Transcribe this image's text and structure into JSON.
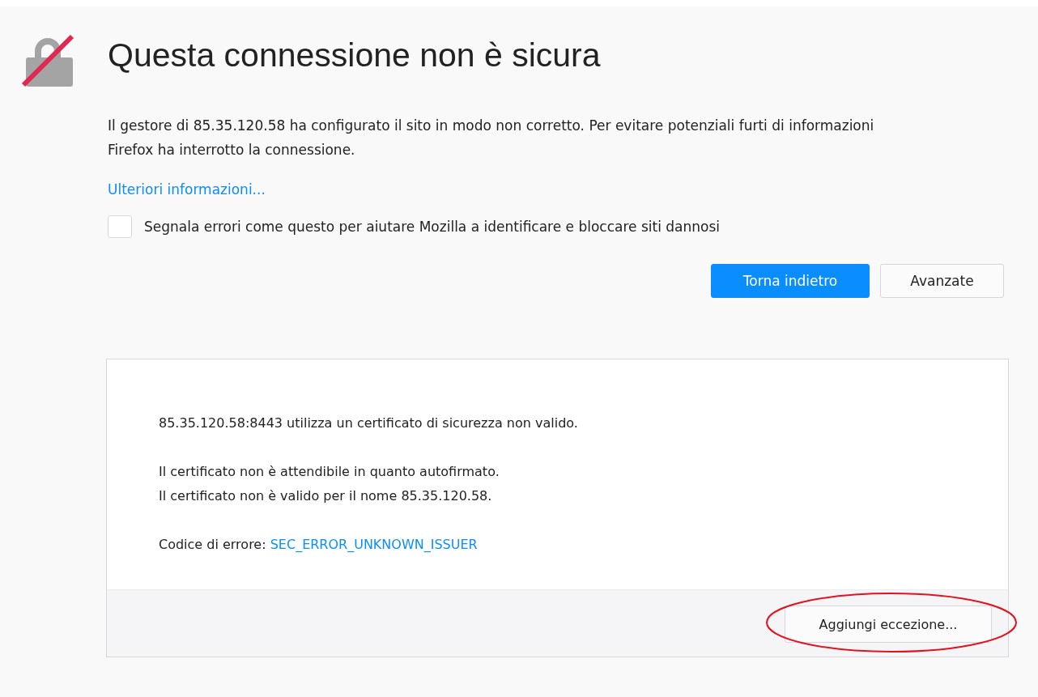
{
  "title": "Questa connessione non è sicura",
  "description": "Il gestore di 85.35.120.58 ha configurato il sito in modo non corretto. Per evitare potenziali furti di informazioni Firefox ha interrotto la connessione.",
  "learn_more_link": "Ulteriori informazioni...",
  "report_checkbox": {
    "label": "Segnala errori come questo per aiutare Mozilla a identificare e bloccare siti dannosi",
    "checked": false
  },
  "buttons": [
    {
      "label": "Torna indietro",
      "kind": "primary"
    },
    {
      "label": "Avanzate",
      "kind": "secondary"
    }
  ],
  "advanced_panel": {
    "message": "85.35.120.58:8443 utilizza un certificato di sicurezza non valido.",
    "details": [
      "Il certificato non è attendibile in quanto autofirmato.",
      "Il certificato non è valido per il nome 85.35.120.58."
    ],
    "error_code_label": "Codice di errore:",
    "error_code": "SEC_ERROR_UNKNOWN_ISSUER",
    "add_exception_button": {
      "label": "Aggiungi eccezione...",
      "circled": true
    }
  }
}
